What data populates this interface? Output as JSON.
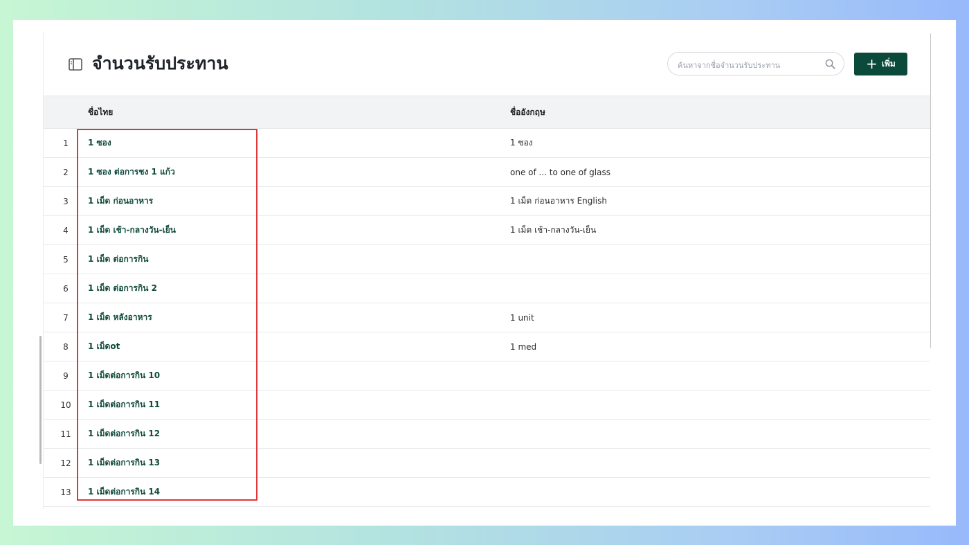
{
  "page": {
    "title": "จำนวนรับประทาน"
  },
  "search": {
    "placeholder": "ค้นหาจากชื่อจำนวนรับประทาน",
    "value": ""
  },
  "toolbar": {
    "add_label": "เพิ่ม"
  },
  "table": {
    "columns": [
      "",
      "ชื่อไทย",
      "ชื่ออังกฤษ"
    ],
    "rows": [
      {
        "no": "1",
        "thai": "1 ซอง",
        "english": "1 ซอง"
      },
      {
        "no": "2",
        "thai": "1 ซอง ต่อการชง 1 แก้ว",
        "english": "one of ... to one of glass"
      },
      {
        "no": "3",
        "thai": "1 เม็ด ก่อนอาหาร",
        "english": "1 เม็ด ก่อนอาหาร English"
      },
      {
        "no": "4",
        "thai": "1 เม็ด เช้า-กลางวัน-เย็น",
        "english": "1 เม็ด เช้า-กลางวัน-เย็น"
      },
      {
        "no": "5",
        "thai": "1 เม็ด ต่อการกิน",
        "english": ""
      },
      {
        "no": "6",
        "thai": "1 เม็ด ต่อการกิน 2",
        "english": ""
      },
      {
        "no": "7",
        "thai": "1 เม็ด หลังอาหาร",
        "english": "1 unit"
      },
      {
        "no": "8",
        "thai": "1 เม็ดot",
        "english": "1 med"
      },
      {
        "no": "9",
        "thai": "1 เม็ดต่อการกิน 10",
        "english": ""
      },
      {
        "no": "10",
        "thai": "1 เม็ดต่อการกิน 11",
        "english": ""
      },
      {
        "no": "11",
        "thai": "1 เม็ดต่อการกิน 12",
        "english": ""
      },
      {
        "no": "12",
        "thai": "1 เม็ดต่อการกิน 13",
        "english": ""
      },
      {
        "no": "13",
        "thai": "1 เม็ดต่อการกิน 14",
        "english": ""
      }
    ]
  },
  "colors": {
    "accent": "#0b4a3b",
    "highlight": "#e0363a",
    "header_bg": "#f2f3f4"
  },
  "icons": {
    "title": "sidebar-panel-icon",
    "search": "search-icon",
    "add": "plus-icon"
  }
}
